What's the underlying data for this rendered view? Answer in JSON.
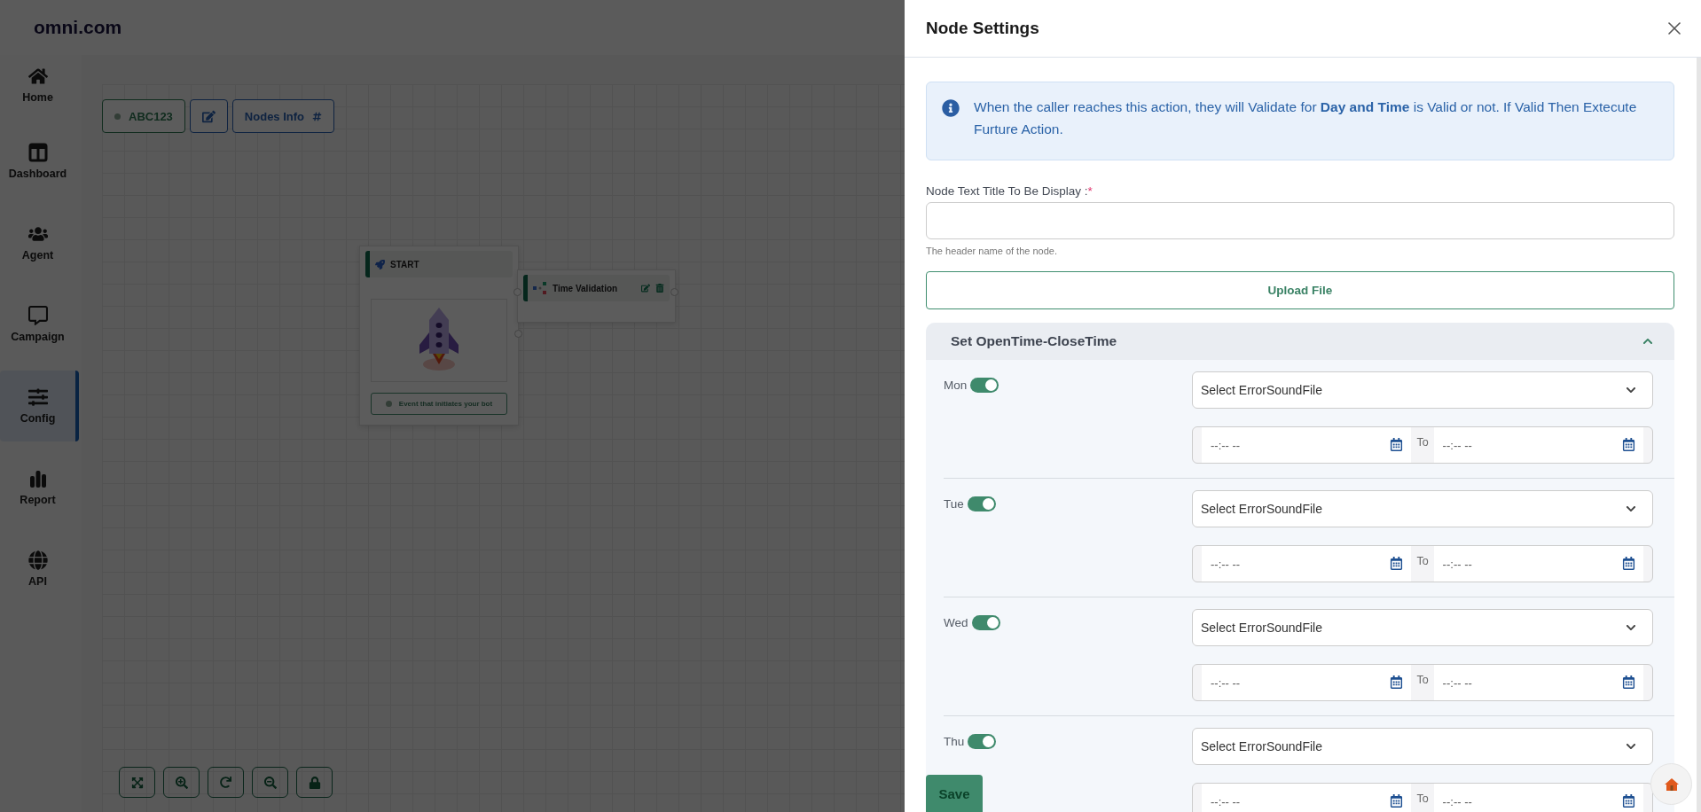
{
  "header": {
    "brand": "omni.com"
  },
  "sidebar": {
    "items": [
      {
        "label": "Home",
        "selected": false
      },
      {
        "label": "Dashboard",
        "selected": false
      },
      {
        "label": "Agent",
        "selected": false
      },
      {
        "label": "Campaign",
        "selected": false
      },
      {
        "label": "Config",
        "selected": true
      },
      {
        "label": "Report",
        "selected": false
      },
      {
        "label": "API",
        "selected": false
      }
    ]
  },
  "toolbar": {
    "flow_name": "ABC123",
    "nodes_info": "Nodes Info"
  },
  "canvas": {
    "nodes": [
      {
        "kind": "start",
        "title": "START",
        "caption": "Event that initiates your bot"
      },
      {
        "kind": "action",
        "title": "Time Validation"
      }
    ]
  },
  "panel": {
    "title": "Node Settings",
    "info": "When the caller reaches this action, they will Validate for **Day and Time** is Valid or not. If Valid Then Extecute Furture Action.",
    "field": {
      "label": "Node Text Title To Be Display :",
      "required_mark": "*",
      "hint": "The header name of the node."
    },
    "upload_button": "Upload File",
    "accordion": {
      "title": "Set OpenTime-CloseTime",
      "expanded": true,
      "days": [
        {
          "name": "Mon",
          "enabled": true,
          "sound_placeholder": "Select ErrorSoundFile",
          "from_placeholder": "--:-- --",
          "to_label": "To",
          "to_placeholder": "--:-- --"
        },
        {
          "name": "Tue",
          "enabled": true,
          "sound_placeholder": "Select ErrorSoundFile",
          "from_placeholder": "--:-- --",
          "to_label": "To",
          "to_placeholder": "--:-- --"
        },
        {
          "name": "Wed",
          "enabled": true,
          "sound_placeholder": "Select ErrorSoundFile",
          "from_placeholder": "--:-- --",
          "to_label": "To",
          "to_placeholder": "--:-- --"
        },
        {
          "name": "Thu",
          "enabled": true,
          "sound_placeholder": "Select ErrorSoundFile",
          "from_placeholder": "--:-- --",
          "to_label": "To",
          "to_placeholder": "--:-- --"
        }
      ]
    },
    "save_button": "Save"
  }
}
